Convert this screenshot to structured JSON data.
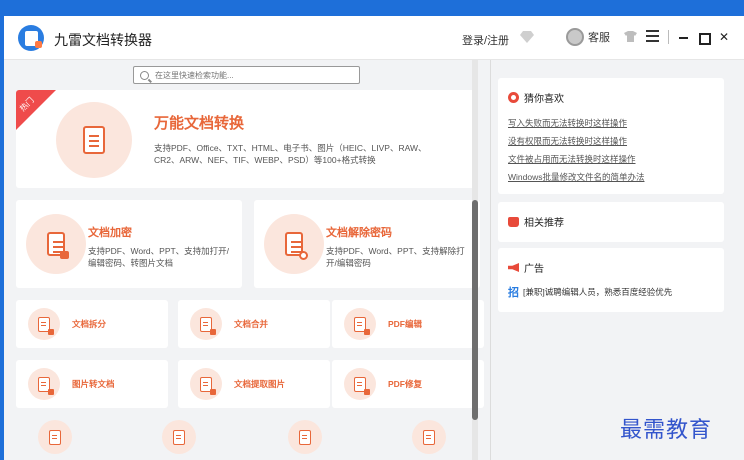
{
  "app": {
    "title": "九雷文档转换器",
    "login_label": "登录/注册",
    "customer_service_label": "客服",
    "icons": [
      "app-logo-icon",
      "vip-diamond-icon",
      "customer-service-icon",
      "skin-shirt-icon",
      "menu-icon",
      "minimize-icon",
      "maximize-icon",
      "close-icon"
    ]
  },
  "search": {
    "placeholder": "在这里快速检索功能..."
  },
  "hero": {
    "hot_tag": "热门",
    "title": "万能文档转换",
    "desc": "支持PDF、Office、TXT、HTML、电子书、图片（HEIC、LIVP、RAW、CR2、ARW、NEF、TIF、WEBP、PSD）等100+格式转换"
  },
  "features": [
    {
      "title": "文档加密",
      "desc": "支持PDF、Word、PPT、支持加打开/编辑密码、转图片文档"
    },
    {
      "title": "文档解除密码",
      "desc": "支持PDF、Word、PPT、支持解除打开/编辑密码"
    }
  ],
  "tools": [
    {
      "label": "文档拆分",
      "icon": "doc-split-icon"
    },
    {
      "label": "文档合并",
      "icon": "doc-merge-icon"
    },
    {
      "label": "PDF编辑",
      "icon": "pdf-edit-icon"
    },
    {
      "label": "图片转文档",
      "icon": "image-to-doc-icon"
    },
    {
      "label": "文档提取图片",
      "icon": "extract-image-icon"
    },
    {
      "label": "PDF修复",
      "icon": "pdf-repair-icon"
    }
  ],
  "sidebar": {
    "guess": {
      "title": "猜你喜欢",
      "links": [
        "写入失败而无法转换时这样操作",
        "没有权限而无法转换时这样操作",
        "文件被占用而无法转换时这样操作",
        "Windows批量修改文件名的简单办法"
      ]
    },
    "recommend": {
      "title": "相关推荐"
    },
    "ad": {
      "title": "广告",
      "badge": "招",
      "text": "[兼职]诚聘编辑人员，熟悉百度经验优先"
    }
  },
  "watermark": "最需教育",
  "colors": {
    "accent": "#e8673a",
    "hot_tag": "#ef4b4b",
    "brand_blue": "#2a7de1",
    "desktop": "#1e6fd9"
  }
}
